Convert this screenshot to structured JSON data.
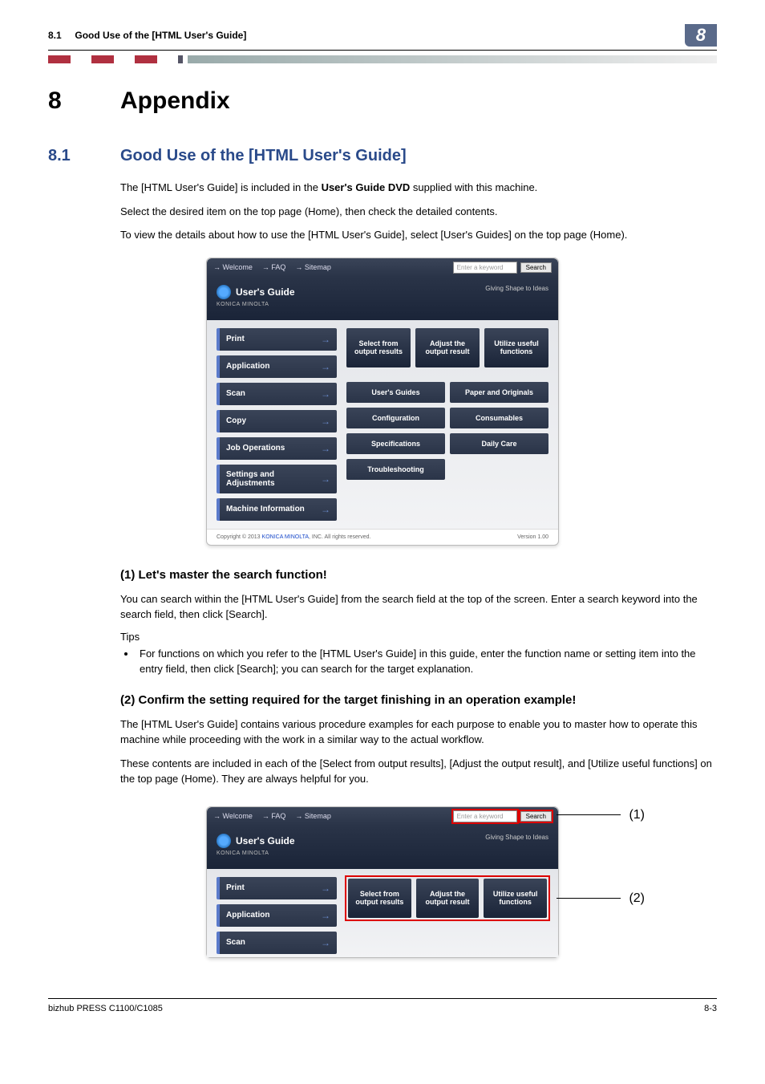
{
  "header": {
    "section_num": "8.1",
    "section_title": "Good Use of the [HTML User's Guide]",
    "chapter_badge": "8"
  },
  "chapter": {
    "num": "8",
    "title": "Appendix"
  },
  "section": {
    "num": "8.1",
    "title": "Good Use of the [HTML User's Guide]"
  },
  "intro": {
    "p1_a": "The [HTML User's Guide] is included in the ",
    "p1_b": "User's Guide DVD",
    "p1_c": " supplied with this machine.",
    "p2": "Select the desired item on the top page (Home), then check the detailed contents.",
    "p3": "To view the details about how to use the [HTML User's Guide], select [User's Guides] on the top page (Home)."
  },
  "screenshot": {
    "nav": {
      "welcome": "→ Welcome",
      "faq": "→ FAQ",
      "sitemap": "→ Sitemap"
    },
    "search_placeholder": "Enter a keyword",
    "search_btn": "Search",
    "logo_text": "User's Guide",
    "brand": "KONICA MINOLTA",
    "tagline": "Giving Shape to Ideas",
    "left_items": [
      "Print",
      "Application",
      "Scan",
      "Copy",
      "Job Operations",
      "Settings and Adjustments",
      "Machine Information"
    ],
    "top_tiles": [
      "Select from output results",
      "Adjust the output result",
      "Utilize useful functions"
    ],
    "grid_tiles": [
      "User's Guides",
      "Paper and Originals",
      "Configuration",
      "Consumables",
      "Specifications",
      "Daily Care",
      "Troubleshooting"
    ],
    "footer_copyright_a": "Copyright © 2013 ",
    "footer_copyright_link": "KONICA MINOLTA",
    "footer_copyright_b": ", INC. All rights reserved.",
    "footer_version": "Version 1.00"
  },
  "sub1": {
    "title": "(1) Let's master the search function!",
    "p1": "You can search within the [HTML User's Guide] from the search field at the top of the screen. Enter a search keyword into the search field, then click [Search].",
    "tips_label": "Tips",
    "tip1": "For functions on which you refer to the [HTML User's Guide] in this guide, enter the function name or setting item into the entry field, then click [Search]; you can search for the target explanation."
  },
  "sub2": {
    "title": "(2) Confirm the setting required for the target finishing in an operation example!",
    "p1": "The [HTML User's Guide] contains various procedure examples for each purpose to enable you to master how to operate this machine while proceeding with the work in a similar way to the actual workflow.",
    "p2": "These contents are included in each of the [Select from output results], [Adjust the output result], and [Utilize useful functions] on the top page (Home). They are always helpful for you."
  },
  "callouts": {
    "c1": "(1)",
    "c2": "(2)"
  },
  "footer": {
    "left": "bizhub PRESS C1100/C1085",
    "right": "8-3"
  }
}
